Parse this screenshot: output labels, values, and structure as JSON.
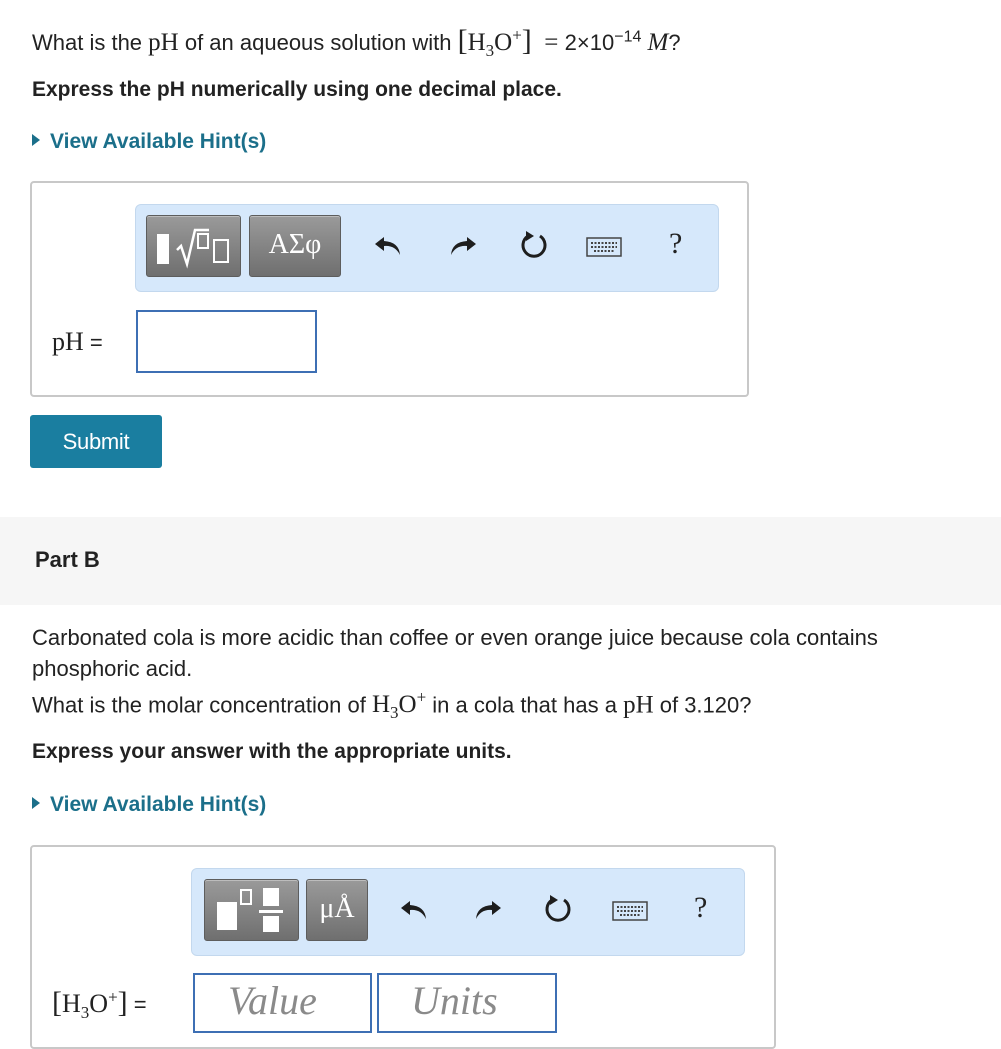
{
  "partA": {
    "question_prefix": "What is the ",
    "ph_symbol": "pH",
    "question_middle": " of an aqueous solution with ",
    "concentration_value": "2×10",
    "concentration_exponent": "−14",
    "molar_symbol": "M",
    "question_end": "?",
    "instruction": "Express the pH numerically using one decimal place.",
    "hint_link": "View Available Hint(s)",
    "toolbar": {
      "templates_icon": "radical-template-icon",
      "greek_label": "ΑΣφ",
      "undo_icon": "undo-icon",
      "redo_icon": "redo-icon",
      "reset_icon": "reset-icon",
      "keyboard_icon": "keyboard-icon",
      "help_label": "?"
    },
    "answer_label": "pH",
    "answer_eq": " =",
    "answer_value": "",
    "submit_label": "Submit"
  },
  "partB": {
    "title": "Part B",
    "intro_line1": "Carbonated cola is more acidic than coffee or even orange juice because cola contains",
    "intro_line2": "phosphoric acid.",
    "question_prefix": "What is the molar concentration of ",
    "question_middle": " in a cola that has a ",
    "ph_symbol": "pH",
    "question_end": " of 3.120?",
    "instruction": "Express your answer with the appropriate units.",
    "hint_link": "View Available Hint(s)",
    "toolbar": {
      "templates_icon": "fraction-template-icon",
      "units_label": "μÅ",
      "undo_icon": "undo-icon",
      "redo_icon": "redo-icon",
      "reset_icon": "reset-icon",
      "keyboard_icon": "keyboard-icon",
      "help_label": "?"
    },
    "answer_eq": " =",
    "value_placeholder": "Value",
    "units_placeholder": "Units"
  },
  "colors": {
    "link": "#1b6f8a",
    "submit_bg": "#1a7ea0",
    "toolbar_bg": "#d6e8fb",
    "input_border": "#3d6fb4"
  }
}
